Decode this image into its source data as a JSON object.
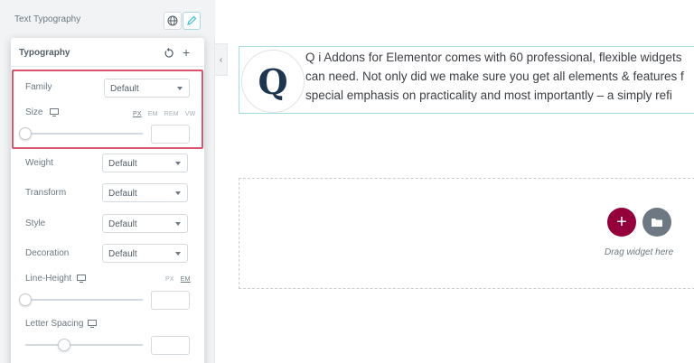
{
  "panel": {
    "section_label": "Text Typography",
    "globe_icon": "globe-icon",
    "pencil_icon": "pencil-icon",
    "collapse_glyph": "‹"
  },
  "popover": {
    "title": "Typography",
    "reset_icon": "reset-icon",
    "add_glyph": "+"
  },
  "fields": {
    "family": {
      "label": "Family",
      "value": "Default"
    },
    "size": {
      "label": "Size",
      "units": [
        "PX",
        "EM",
        "REM",
        "VW"
      ],
      "active_unit": "PX",
      "value": ""
    },
    "weight": {
      "label": "Weight",
      "value": "Default"
    },
    "transform": {
      "label": "Transform",
      "value": "Default"
    },
    "style": {
      "label": "Style",
      "value": "Default"
    },
    "decoration": {
      "label": "Decoration",
      "value": "Default"
    },
    "line_height": {
      "label": "Line-Height",
      "units": [
        "PX",
        "EM"
      ],
      "active_unit": "EM",
      "value": ""
    },
    "letter_spacing": {
      "label": "Letter Spacing",
      "value": ""
    }
  },
  "canvas": {
    "logo_letter": "Q",
    "text_lines": [
      "Q i Addons for Elementor comes with 60 professional, flexible widgets",
      "can need. Not only did we make sure you get all elements & features f",
      "special emphasis on practicality and most importantly – a simply refi"
    ],
    "add_glyph": "+",
    "drag_text": "Drag widget here"
  },
  "colors": {
    "accent_highlight": "#d9546d",
    "add_button": "#93003c",
    "folder_button": "#6d7882",
    "content_border": "#a8dde4"
  }
}
